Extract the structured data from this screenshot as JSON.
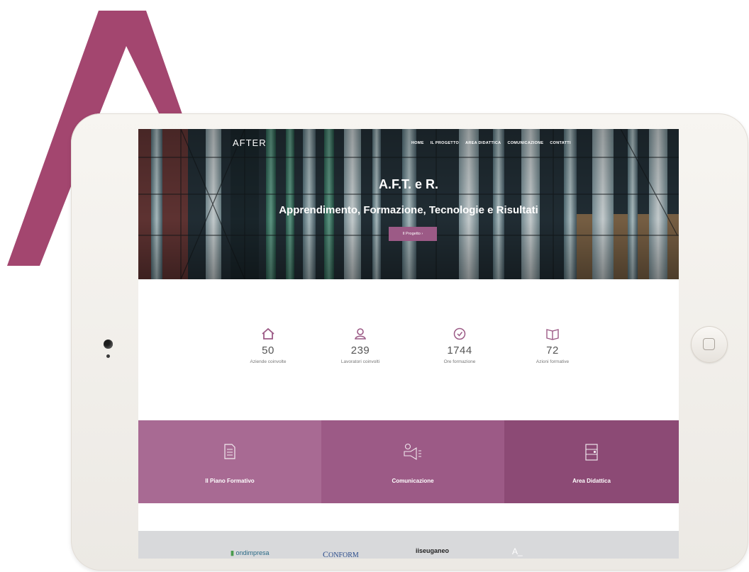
{
  "hero": {
    "logo_text": "AFTER",
    "nav_items": [
      "HOME",
      "IL PROGETTO",
      "AREA DIDATTICA",
      "COMUNICAZIONE",
      "CONTATTI"
    ],
    "title": "A.F.T. e R.",
    "subtitle": "Apprendimento, Formazione, Tecnologie e Risultati",
    "button_label": "Il Progetto  ›"
  },
  "stats": [
    {
      "value": "50",
      "label": "Aziende coinvolte",
      "icon": "house-icon"
    },
    {
      "value": "239",
      "label": "Lavoratori coinvolti",
      "icon": "users-icon"
    },
    {
      "value": "1744",
      "label": "Ore formazione",
      "icon": "clock-icon"
    },
    {
      "value": "72",
      "label": "Azioni formative",
      "icon": "book-icon"
    }
  ],
  "tiles": [
    {
      "label": "Il Piano Formativo",
      "color": "#a86a93",
      "icon": "document-icon"
    },
    {
      "label": "Comunicazione",
      "color": "#9c5a86",
      "icon": "megaphone-icon"
    },
    {
      "label": "Area Didattica",
      "color": "#8c4a75",
      "icon": "building-icon"
    }
  ],
  "partners": [
    "ondimpresa",
    "ONFORM",
    "iiseuganeo"
  ],
  "colors": {
    "accent": "#9c5a86",
    "big_letter": "#a3466f"
  }
}
